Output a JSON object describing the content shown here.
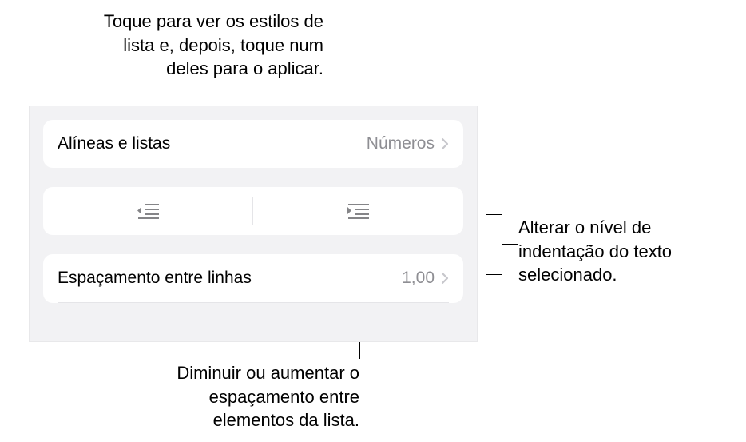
{
  "callouts": {
    "top": "Toque para ver os estilos de lista e, depois, toque num deles para o aplicar.",
    "right": "Alterar o nível de indentação do texto selecionado.",
    "bottom": "Diminuir ou aumentar o espaçamento entre elementos da lista."
  },
  "panel": {
    "bullets_label": "Alíneas e listas",
    "bullets_value": "Números",
    "spacing_label": "Espaçamento entre linhas",
    "spacing_value": "1,00"
  }
}
